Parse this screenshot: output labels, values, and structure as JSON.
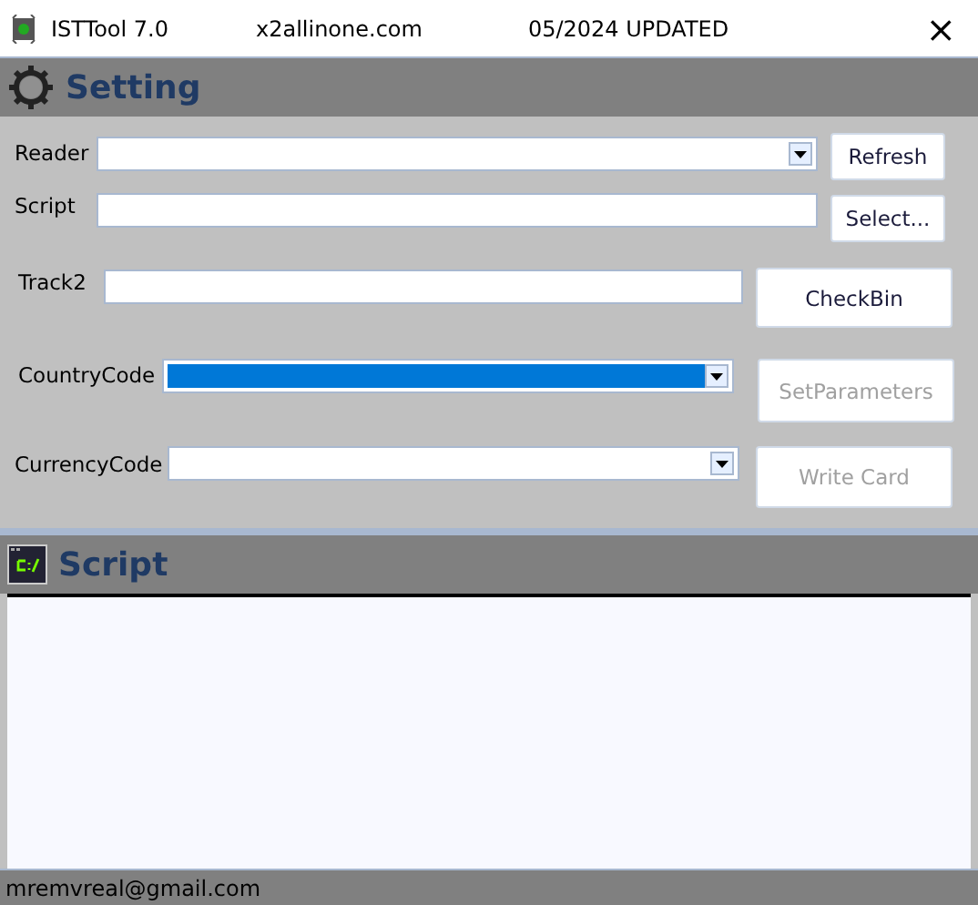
{
  "window": {
    "title": "ISTTool 7.0",
    "site": "x2allinone.com",
    "note": "05/2024 UPDATED",
    "close": "×"
  },
  "setting": {
    "title": "Setting",
    "rows": [
      {
        "label": "Reader",
        "kind": "combo",
        "highlighted": false,
        "button": {
          "label": "Refresh",
          "disabled": false
        }
      },
      {
        "label": "Script",
        "kind": "text",
        "button": {
          "label": "Select...",
          "disabled": false
        }
      },
      {
        "label": "Track2",
        "kind": "text",
        "button": {
          "label": "CheckBin",
          "disabled": false
        }
      },
      {
        "label": "CountryCode",
        "kind": "combo",
        "highlighted": true,
        "button": {
          "label": "SetParameters",
          "disabled": true
        }
      },
      {
        "label": "CurrencyCode",
        "kind": "combo",
        "highlighted": false,
        "button": {
          "label": "Write Card",
          "disabled": true
        }
      }
    ]
  },
  "script": {
    "title": "Script"
  },
  "status_bar": {
    "text": "mremvreal@gmail.com"
  }
}
